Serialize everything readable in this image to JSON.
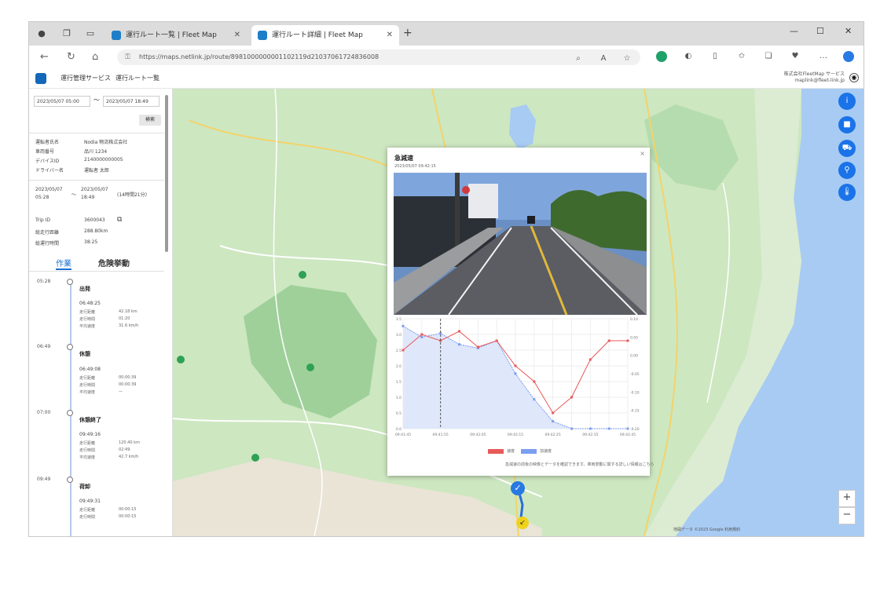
{
  "browser": {
    "tabs": [
      {
        "label": "運行ルート一覧 | Fleet Map",
        "active": false
      },
      {
        "label": "運行ルート詳細 | Fleet Map",
        "active": true
      }
    ],
    "new_tab": "+",
    "url": "https://maps.netlink.jp/route/8981000000001102119d21037061724836008",
    "window_controls": [
      "—",
      "☐",
      "✕"
    ]
  },
  "app": {
    "nav": [
      "運行管理サービス",
      "運行ルート一覧"
    ],
    "account": [
      "株式会社FleetMap サービス",
      "maplink@fleet-link.jp"
    ]
  },
  "filter": {
    "date_from": "2023/05/07 05:00",
    "date_to": "2023/05/07 18:49",
    "tilde": "〜",
    "search_label": "検索"
  },
  "vehicle": [
    {
      "k": "運転者氏名",
      "v": "Nodia 物流株式会社"
    },
    {
      "k": "車両番号",
      "v": "品川 1234"
    },
    {
      "k": "デバイスID",
      "v": "2140000000005"
    },
    {
      "k": "ドライバー名",
      "v": "運転者 太郎"
    }
  ],
  "trip": {
    "start": "2023/05/07 05:28",
    "end": "2023/05/07 18:49",
    "duration": "(14時間21分)",
    "rows": [
      {
        "k": "Trip ID",
        "v": "3600043"
      },
      {
        "k": "総走行距離",
        "v": "288.80km"
      },
      {
        "k": "総運行時間",
        "v": "38:25"
      }
    ]
  },
  "side_tabs": [
    "作業",
    "危険挙動"
  ],
  "timeline": [
    {
      "time": "05:28",
      "title": "出発",
      "sub": "",
      "rows": []
    },
    {
      "time": "",
      "title": "",
      "sub": "06:48:25",
      "rows": [
        {
          "k": "走行距離",
          "v": "42.18 km"
        },
        {
          "k": "走行時間",
          "v": "01:20"
        },
        {
          "k": "平均速度",
          "v": "31.6 km/h"
        }
      ]
    },
    {
      "time": "06:49",
      "title": "休憩",
      "sub": "",
      "rows": []
    },
    {
      "time": "",
      "title": "",
      "sub": "06:49:08",
      "rows": [
        {
          "k": "走行距離",
          "v": "00:00:39"
        },
        {
          "k": "走行時間",
          "v": "00:00:39"
        },
        {
          "k": "平均速度",
          "v": "—"
        }
      ]
    },
    {
      "time": "07:00",
      "title": "休憩終了",
      "sub": "",
      "rows": []
    },
    {
      "time": "",
      "title": "",
      "sub": "09:49:16",
      "rows": [
        {
          "k": "走行距離",
          "v": "120.40 km"
        },
        {
          "k": "走行時間",
          "v": "02:49"
        },
        {
          "k": "平均速度",
          "v": "42.7 km/h"
        }
      ]
    },
    {
      "time": "09:49",
      "title": "荷卸",
      "sub": "09:49:31",
      "rows": [
        {
          "k": "走行距離",
          "v": "00:00:15"
        },
        {
          "k": "走行時間",
          "v": "00:00:15"
        }
      ]
    }
  ],
  "popup": {
    "title": "急減速",
    "subtitle": "2023/05/07 09:42:15",
    "close": "×",
    "legend": [
      "速度",
      "加速度"
    ],
    "footer": "急減速の前後の映像とデータを確認できます。車両挙動に関する詳しい情報はこちら",
    "colors": {
      "speed": "#e85a5a",
      "accel": "#7a9ef0"
    }
  },
  "map": {
    "controls": [
      "info-icon",
      "camera-icon",
      "truck-icon",
      "pin-icon",
      "thermometer-icon"
    ],
    "zoom_in": "+",
    "zoom_out": "−",
    "attribution": "地図データ ©2023 Google 利用規約"
  },
  "chart_data": {
    "type": "line",
    "x": [
      "09:41:45",
      "09:41:50",
      "09:41:55",
      "09:42:00",
      "09:42:05",
      "09:42:10",
      "09:42:15",
      "09:42:20",
      "09:42:25",
      "09:42:30",
      "09:42:35",
      "09:42:40",
      "09:42:45"
    ],
    "series": [
      {
        "name": "速度",
        "axis": "left",
        "values": [
          2.5,
          3.0,
          2.8,
          3.1,
          2.6,
          2.8,
          2.0,
          1.5,
          0.5,
          1.0,
          2.2,
          2.8,
          2.8
        ]
      },
      {
        "name": "加速度",
        "axis": "right",
        "values": [
          0.08,
          0.05,
          0.06,
          0.03,
          0.02,
          0.04,
          -0.05,
          -0.12,
          -0.18,
          -0.2,
          -0.2,
          -0.2,
          -0.2
        ]
      }
    ],
    "ylim_left": [
      0,
      3.5
    ],
    "ylim_right": [
      -0.2,
      0.1
    ],
    "grid": true,
    "legend": "bottom"
  }
}
